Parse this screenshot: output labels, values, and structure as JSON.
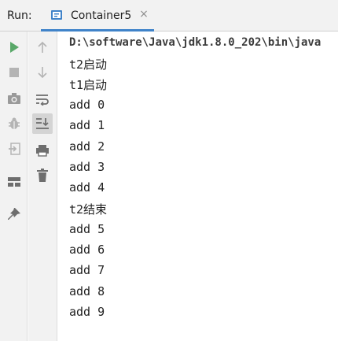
{
  "titlebar": {
    "run_label": "Run:",
    "tab": {
      "title": "Container5",
      "icon": "java-class-icon",
      "close": "×"
    }
  },
  "left_toolbar": [
    {
      "name": "rerun-icon"
    },
    {
      "name": "stop-icon"
    },
    {
      "name": "camera-icon"
    },
    {
      "name": "debug-bug-icon"
    },
    {
      "name": "exit-icon"
    },
    {
      "name": "layout-icon"
    },
    {
      "name": "pin-icon"
    }
  ],
  "second_toolbar": [
    {
      "name": "up-arrow-icon"
    },
    {
      "name": "down-arrow-icon"
    },
    {
      "name": "soft-wrap-icon"
    },
    {
      "name": "scroll-to-end-icon"
    },
    {
      "name": "print-icon"
    },
    {
      "name": "trash-icon"
    }
  ],
  "console": {
    "lines": [
      "D:\\software\\Java\\jdk1.8.0_202\\bin\\java",
      "t2启动",
      "t1启动",
      "add 0",
      "add 1",
      "add 2",
      "add 3",
      "add 4",
      "t2结束",
      "add 5",
      "add 6",
      "add 7",
      "add 8",
      "add 9"
    ]
  },
  "colors": {
    "accent": "#4083c9",
    "run_green": "#59a869",
    "icon_gray": "#6e6e6e",
    "disabled_gray": "#b4b4b4"
  }
}
